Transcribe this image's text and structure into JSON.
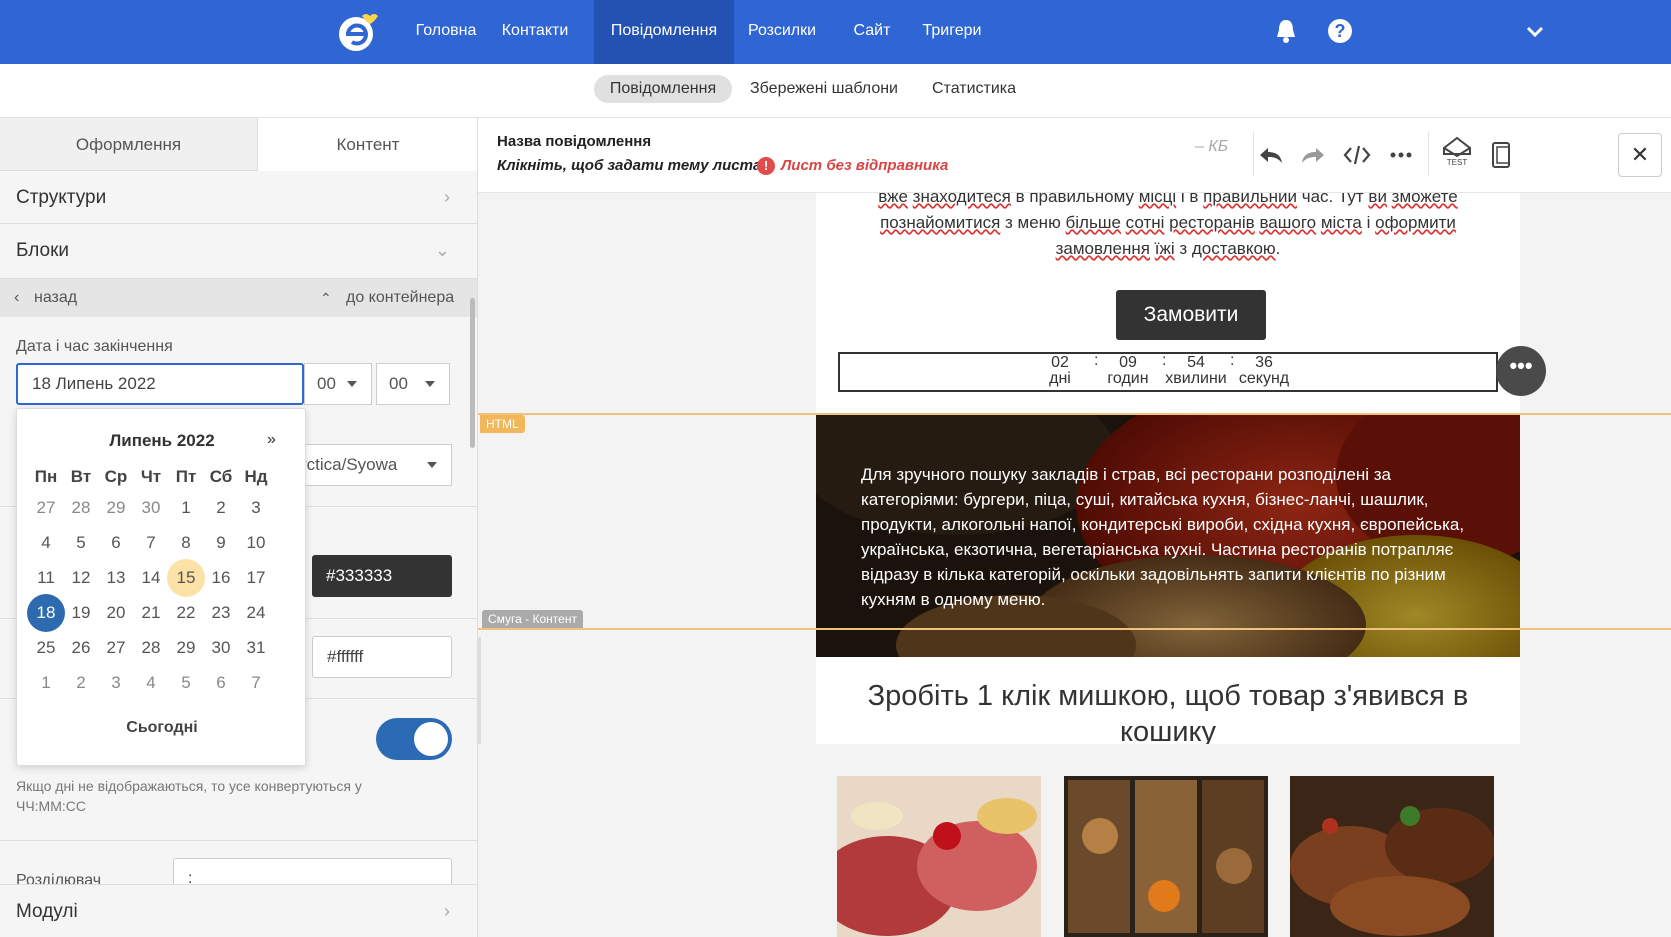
{
  "topnav": {
    "items": [
      "Головна",
      "Контакти",
      "Повідомлення",
      "Розсилки",
      "Сайт",
      "Тригери"
    ],
    "active": 2,
    "help": "?",
    "accent": "#2f66d4"
  },
  "subnav": {
    "items": [
      "Повідомлення",
      "Збережені шаблони",
      "Статистика"
    ],
    "active": 0
  },
  "sidebar": {
    "tabs": [
      "Оформлення",
      "Контент"
    ],
    "sections": {
      "structures": "Структури",
      "blocks": "Блоки",
      "modules": "Модулі"
    },
    "back": "назад",
    "to_container": "до контейнера",
    "date_label": "Дата і час закінчення",
    "date_value": "18 Липень 2022",
    "hour": "00",
    "minute": "00",
    "timezone": "rctica/Syowa",
    "color_text": "#333333",
    "color_bg": "#ffffff",
    "hint": "Якщо дні не відображаються, то усе конвертуються у ЧЧ:ММ:СС",
    "divider_label": "Розділювач",
    "divider_value": ":"
  },
  "calendar": {
    "title": "Липень 2022",
    "next": "»",
    "dow": [
      "Пн",
      "Вт",
      "Ср",
      "Чт",
      "Пт",
      "Сб",
      "Нд"
    ],
    "weeks": [
      [
        "27",
        "28",
        "29",
        "30",
        "1",
        "2",
        "3"
      ],
      [
        "4",
        "5",
        "6",
        "7",
        "8",
        "9",
        "10"
      ],
      [
        "11",
        "12",
        "13",
        "14",
        "15",
        "16",
        "17"
      ],
      [
        "18",
        "19",
        "20",
        "21",
        "22",
        "23",
        "24"
      ],
      [
        "25",
        "26",
        "27",
        "28",
        "29",
        "30",
        "31"
      ],
      [
        "1",
        "2",
        "3",
        "4",
        "5",
        "6",
        "7"
      ]
    ],
    "today": "15",
    "selected": "18",
    "footer": "Сьогодні"
  },
  "editor": {
    "message_name": "Назва повідомлення",
    "subject_hint": "Клікніть, щоб задати тему листа",
    "warning": "Лист без відправника",
    "size": "– КБ",
    "close": "✕"
  },
  "email": {
    "intro_lines": [
      [
        "вже",
        " ",
        "знаходитеся",
        " в правильному ",
        "місці",
        " і в ",
        "правильний",
        " час. Тут ",
        "ви",
        " ",
        "зможете"
      ],
      [
        "познайомитися",
        " з меню ",
        "більше",
        " ",
        "сотні",
        " ",
        "ресторанів",
        " ",
        "вашого",
        " ",
        "міста",
        " і ",
        "оформити"
      ],
      [
        "замовлення",
        " ",
        "їжі",
        " з ",
        "доставкою",
        "."
      ]
    ],
    "order_button": "Замовити",
    "timer": [
      {
        "value": "02",
        "label": "дні"
      },
      {
        "value": "09",
        "label": "годин"
      },
      {
        "value": "54",
        "label": "хвилини"
      },
      {
        "value": "36",
        "label": "секунд"
      }
    ],
    "timer_sep": ":",
    "more": "•••",
    "html_tag": "HTML",
    "strip_tag": "Смуга - Контент",
    "banner_text": "Для зручного пошуку закладів і страв, всі ресторани розподілені за категоріями: бургери, піца, суші, китайська кухня, бізнес-ланчі, шашлик, продукти, алкогольні напої, кондитерські вироби, східна кухня, європейська, українська, екзотична, вегетаріанська кухні. Частина ресторанів потрапляє відразу в кілька категорій, оскільки задовільнять запити клієнтів по різним кухням в одному меню.",
    "headline": "Зробіть 1 клік мишкою, щоб товар з'явився в кошику"
  }
}
